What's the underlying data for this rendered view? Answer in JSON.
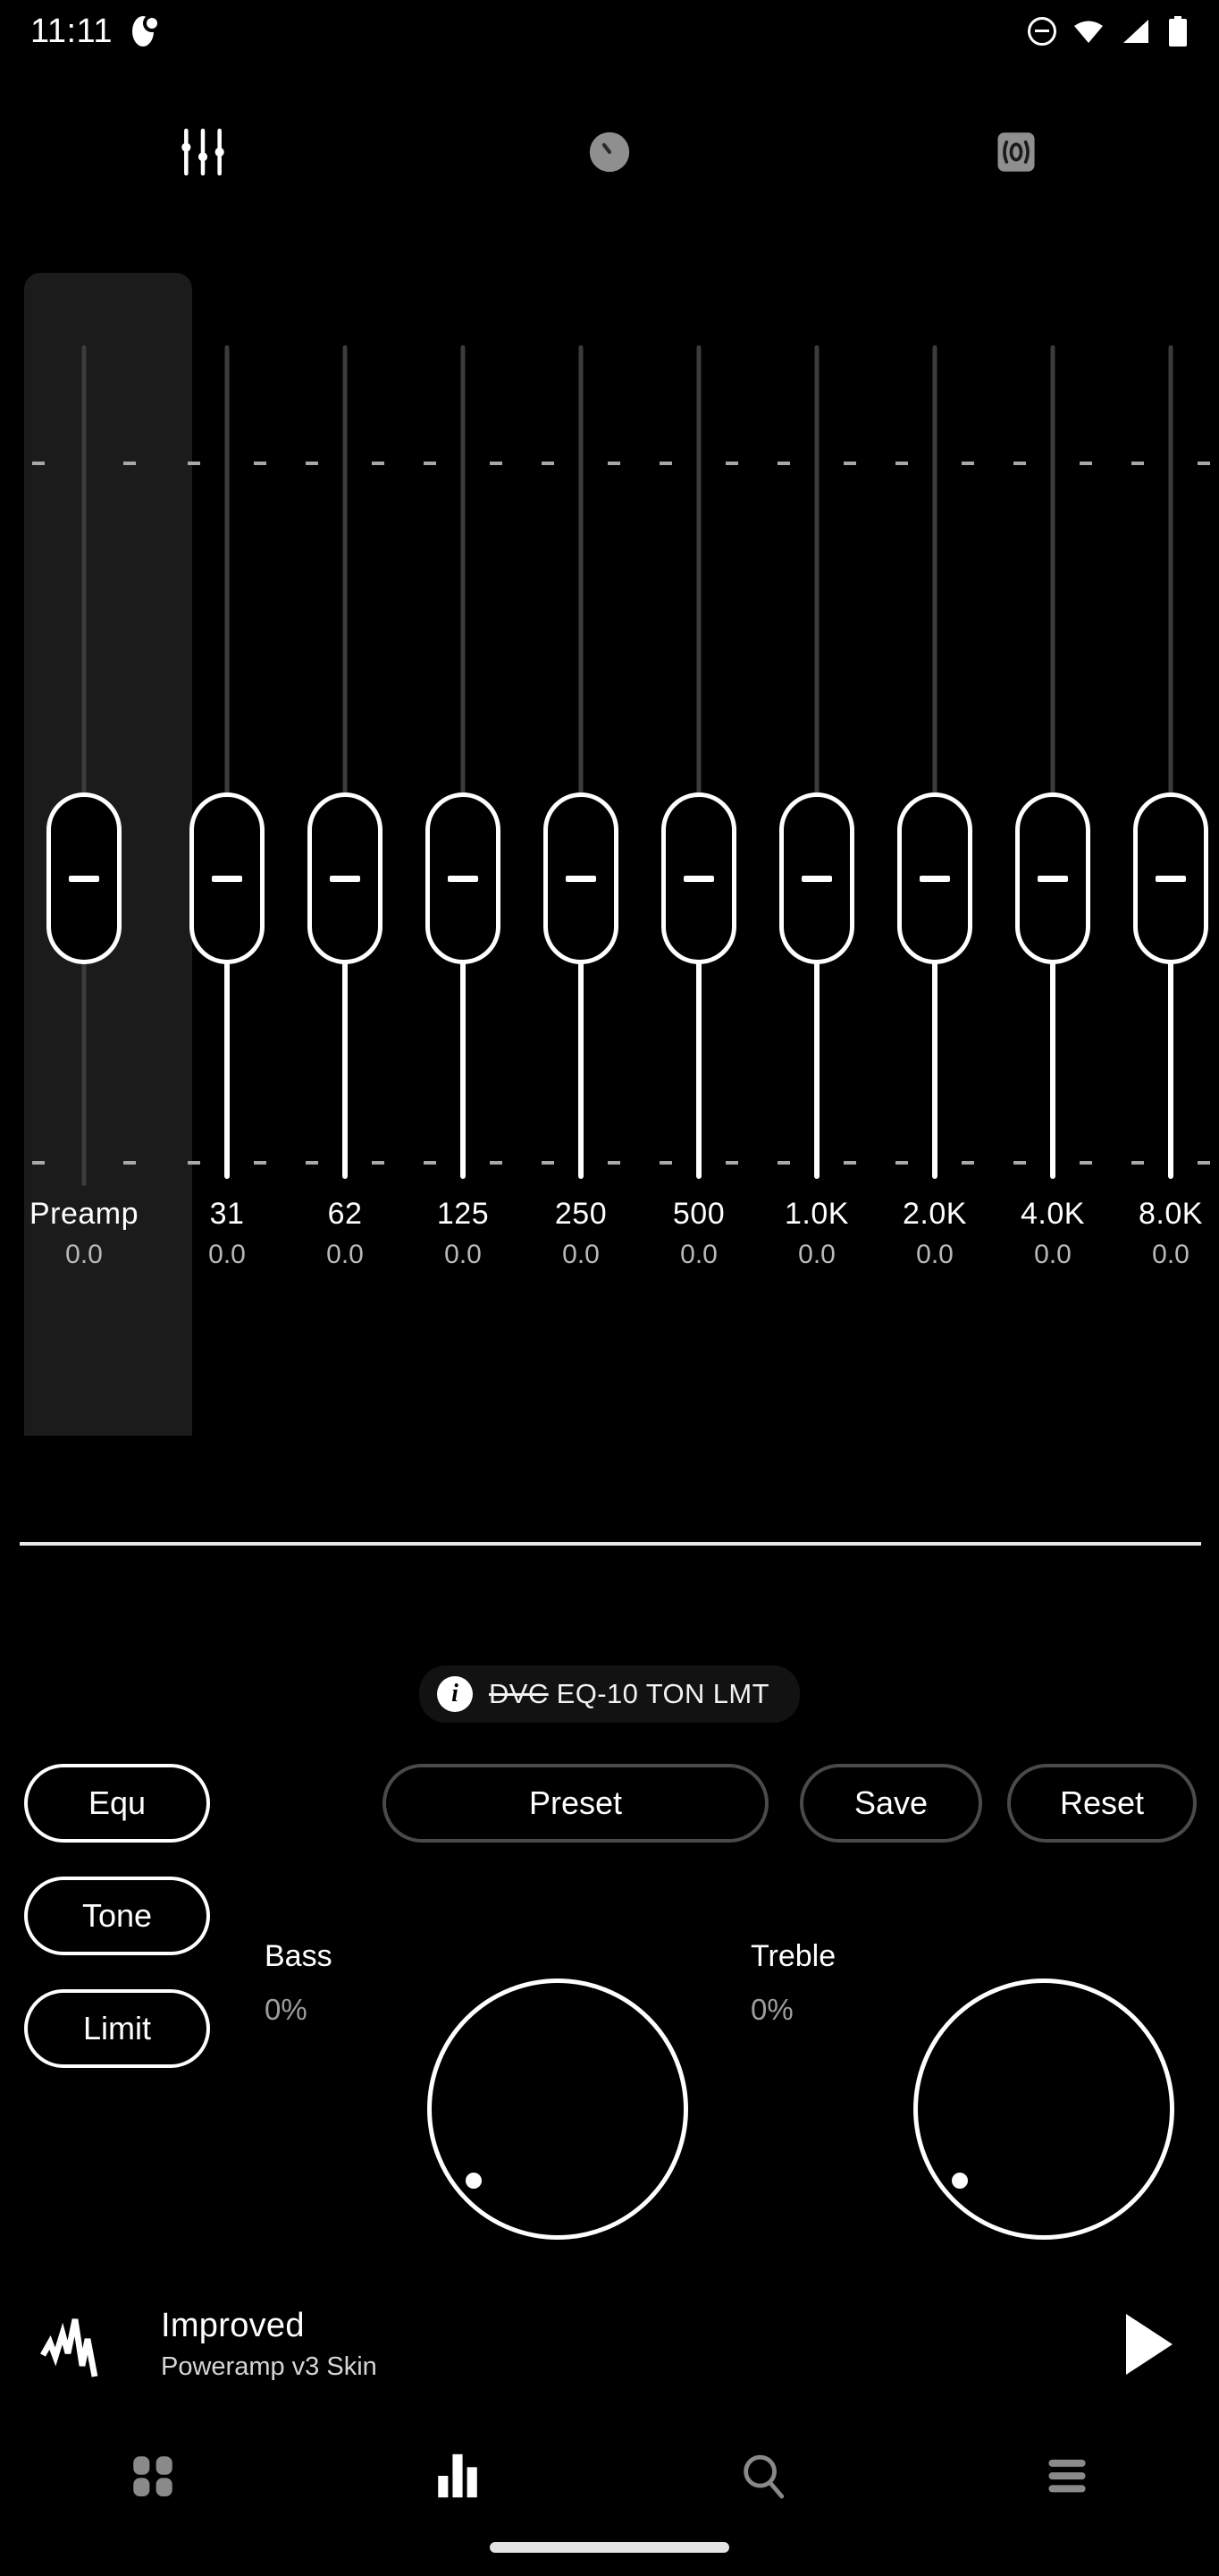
{
  "status_bar": {
    "time": "11:11",
    "icons": [
      "app-badge-icon",
      "do-not-disturb-icon",
      "wifi-icon",
      "cellular-signal-icon",
      "battery-icon"
    ]
  },
  "top_tabs": [
    {
      "name": "equalizer-tab",
      "icon": "equalizer-sliders-icon",
      "active": true
    },
    {
      "name": "tone-tab",
      "icon": "knob-dial-icon",
      "active": false
    },
    {
      "name": "stereo-tab",
      "icon": "stereo-expand-icon",
      "active": false
    }
  ],
  "equalizer": {
    "bands": [
      {
        "label": "Preamp",
        "value": "0.0",
        "preamp": true
      },
      {
        "label": "31",
        "value": "0.0"
      },
      {
        "label": "62",
        "value": "0.0"
      },
      {
        "label": "125",
        "value": "0.0"
      },
      {
        "label": "250",
        "value": "0.0"
      },
      {
        "label": "500",
        "value": "0.0"
      },
      {
        "label": "1.0K",
        "value": "0.0"
      },
      {
        "label": "2.0K",
        "value": "0.0"
      },
      {
        "label": "4.0K",
        "value": "0.0"
      },
      {
        "label": "8.0K",
        "value": "0.0"
      }
    ]
  },
  "info_chip": {
    "icon": "info-icon",
    "strikethrough_text": "DVC",
    "text": " EQ-10 TON LMT",
    "full_text": "DVC EQ-10 TON LMT"
  },
  "buttons": {
    "equ": "Equ",
    "preset": "Preset",
    "save": "Save",
    "reset": "Reset",
    "tone": "Tone",
    "limit": "Limit"
  },
  "tone_controls": {
    "bass": {
      "label": "Bass",
      "value": "0%"
    },
    "treble": {
      "label": "Treble",
      "value": "0%"
    }
  },
  "now_playing": {
    "art_icon": "waveform-icon",
    "title": "Improved",
    "subtitle": "Poweramp v3 Skin",
    "play_icon": "play-icon"
  },
  "bottom_nav": [
    {
      "name": "nav-library",
      "icon": "grid-icon",
      "active": false
    },
    {
      "name": "nav-equalizer",
      "icon": "bars-icon",
      "active": true
    },
    {
      "name": "nav-search",
      "icon": "search-icon",
      "active": false
    },
    {
      "name": "nav-menu",
      "icon": "hamburger-icon",
      "active": false
    }
  ],
  "colors": {
    "background": "#000000",
    "accent": "#ffffff",
    "inactive": "#8a8a8a",
    "panel": "#1b1b1b",
    "border_inactive": "#4a4a4a"
  }
}
